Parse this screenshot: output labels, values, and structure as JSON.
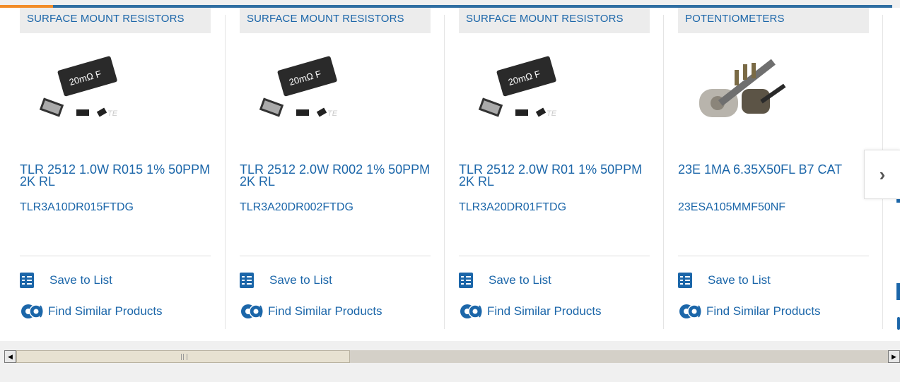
{
  "cards": [
    {
      "category": "SURFACE MOUNT RESISTORS",
      "title": "TLR 2512 1.0W R015 1% 50PPM 2K RL",
      "part_number": "TLR3A10DR015FTDG",
      "image_label": "20mΩ F",
      "save_label": "Save to List",
      "find_label": "Find Similar Products"
    },
    {
      "category": "SURFACE MOUNT RESISTORS",
      "title": "TLR 2512 2.0W R002 1% 50PPM 2K RL",
      "part_number": "TLR3A20DR002FTDG",
      "image_label": "20mΩ F",
      "save_label": "Save to List",
      "find_label": "Find Similar Products"
    },
    {
      "category": "SURFACE MOUNT RESISTORS",
      "title": "TLR 2512 2.0W R01 1% 50PPM 2K RL",
      "part_number": "TLR3A20DR01FTDG",
      "image_label": "20mΩ F",
      "save_label": "Save to List",
      "find_label": "Find Similar Products"
    },
    {
      "category": "POTENTIOMETERS",
      "title": "23E 1MA 6.35X50FL B7 CAT",
      "part_number": "23ESA105MMF50NF",
      "image_label": "",
      "save_label": "Save to List",
      "find_label": "Find Similar Products"
    }
  ],
  "carousel": {
    "next_icon": "chevron-right-icon"
  },
  "colors": {
    "link": "#1b66a9",
    "accent": "#f28c28",
    "brand_bar": "#2f6ea2"
  }
}
